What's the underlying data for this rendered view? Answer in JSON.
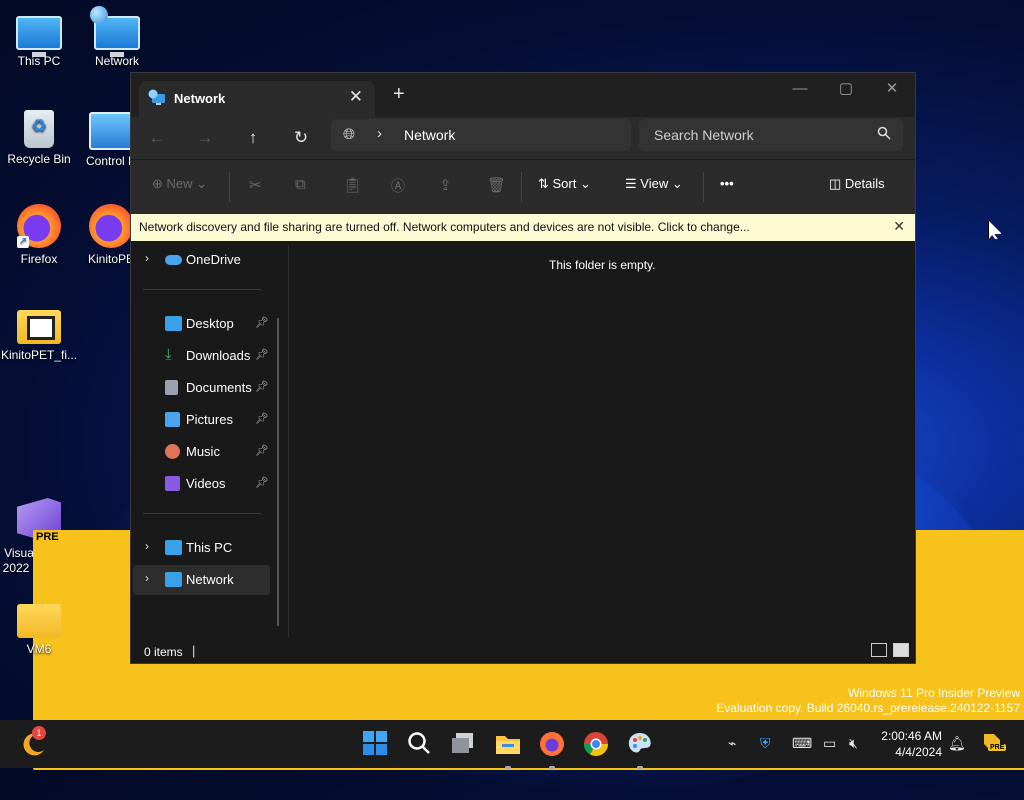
{
  "desktop": {
    "icons": [
      {
        "label": "This PC",
        "icon": "monitor-icon"
      },
      {
        "label": "Network",
        "icon": "network-icon"
      },
      {
        "label": "Recycle Bin",
        "icon": "recycle-bin-icon"
      },
      {
        "label": "Control P",
        "icon": "control-panel-icon"
      },
      {
        "label": "Firefox",
        "icon": "firefox-icon"
      },
      {
        "label": "KinitoPE",
        "icon": "kinito-shortcut-icon"
      },
      {
        "label": "KinitoPET_fi...",
        "icon": "folder-icon"
      },
      {
        "label": "Visual Studio 2022 Preview",
        "icon": "visual-studio-icon",
        "badge": "PRE"
      },
      {
        "label": "VM6",
        "icon": "folder-icon"
      }
    ]
  },
  "explorer": {
    "tab_title": "Network",
    "new_tab": "+",
    "window_controls": {
      "minimize": "—",
      "maximize": "▢",
      "close": "✕"
    },
    "address": {
      "crumb": "Network"
    },
    "search": {
      "placeholder": "Search Network"
    },
    "commands": {
      "new": "New",
      "sort": "Sort",
      "view": "View",
      "more": "•••",
      "details": "Details"
    },
    "infobar": "Network discovery and file sharing are turned off. Network computers and devices are not visible. Click to change...",
    "nav": {
      "onedrive": "OneDrive",
      "quick": [
        {
          "label": "Desktop",
          "color": "#3aa0e8"
        },
        {
          "label": "Downloads",
          "color": "#3bb36a"
        },
        {
          "label": "Documents",
          "color": "#9aa3ad"
        },
        {
          "label": "Pictures",
          "color": "#4aa3ee"
        },
        {
          "label": "Music",
          "color": "#e0735a"
        },
        {
          "label": "Videos",
          "color": "#8a5be0"
        }
      ],
      "this_pc": "This PC",
      "network": "Network"
    },
    "empty_message": "This folder is empty.",
    "status": {
      "count": "0 items"
    }
  },
  "watermark": {
    "line1": "Windows 11 Pro Insider Preview",
    "line2": "Evaluation copy. Build 26040.rs_prerelease.240122-1157"
  },
  "taskbar": {
    "notification_badge": "1",
    "apps": [
      "start-icon",
      "search-icon",
      "task-view-icon",
      "file-explorer-icon",
      "firefox-icon",
      "chrome-icon",
      "paint-icon"
    ],
    "clock": {
      "time": "2:00:46 AM",
      "date": "4/4/2024"
    },
    "tray_badge": "PRE"
  },
  "colors": {
    "accent": "#0078d4",
    "infobar": "#fdfbd3",
    "window_bg": "#191919"
  }
}
